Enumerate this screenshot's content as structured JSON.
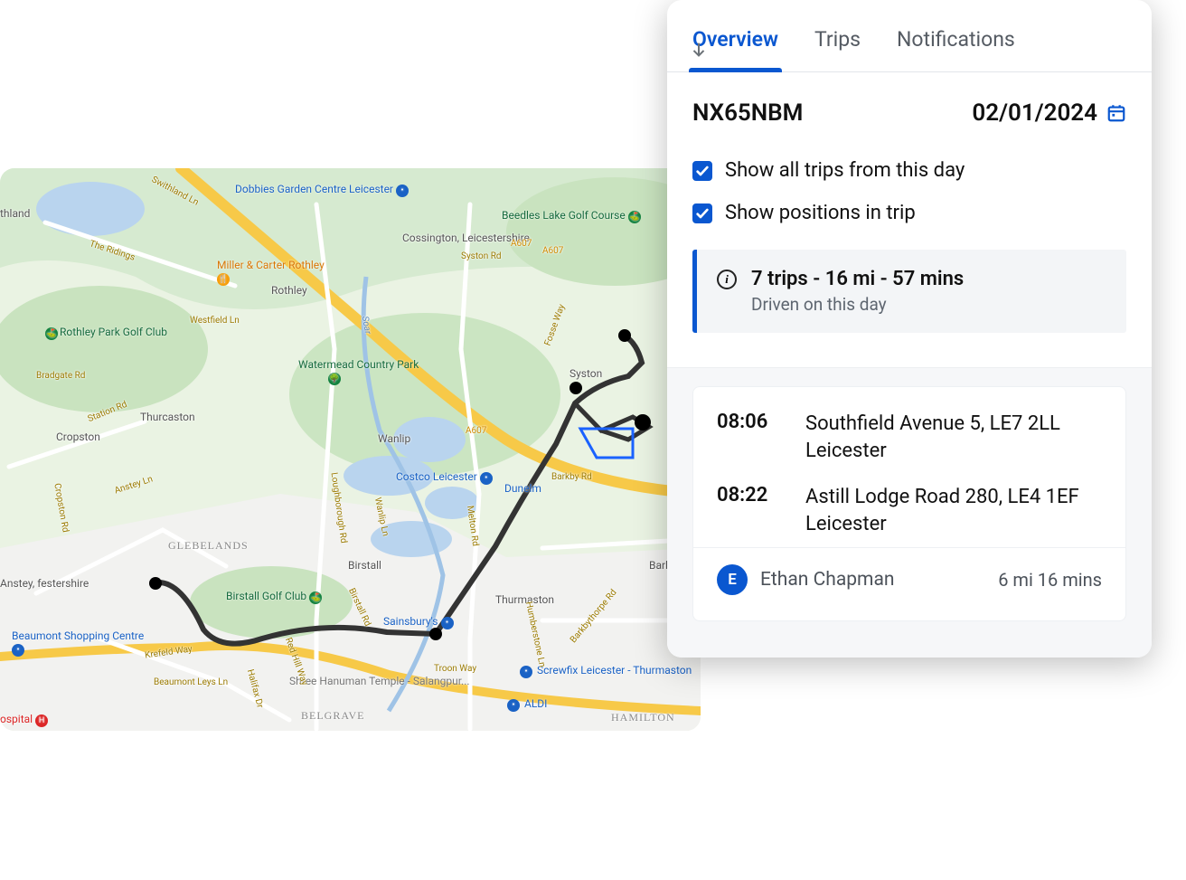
{
  "tabs": {
    "overview": "Overview",
    "trips": "Trips",
    "notifications": "Notifications"
  },
  "header": {
    "vehicle": "NX65NBM",
    "date": "02/01/2024"
  },
  "options": {
    "show_all_trips": "Show all trips from this day",
    "show_positions": "Show positions in trip"
  },
  "summary": {
    "title": "7 trips - 16 mi - 57 mins",
    "subtitle": "Driven on this day"
  },
  "trip": {
    "start_time": "08:06",
    "start_addr_line1": "Southfield Avenue 5, LE7 2LL",
    "start_addr_line2": "Leicester",
    "end_time": "08:22",
    "end_addr_line1": "Astill Lodge Road 280, LE4 1EF",
    "end_addr_line2": "Leicester",
    "driver_initial": "E",
    "driver_name": "Ethan Chapman",
    "meta": "6 mi 16 mins"
  },
  "map": {
    "places": {
      "rothley_golf": "Rothley Park Golf Club",
      "dobbies": "Dobbies Garden Centre Leicester",
      "miller": "Miller & Carter Rothley",
      "watermead": "Watermead Country Park",
      "beedles": "Beedles Lake Golf Course",
      "costco": "Costco Leicester",
      "dunelm": "Dunelm",
      "birstall_golf": "Birstall Golf Club",
      "sainsburys": "Sainsbury's",
      "beaumont": "Beaumont Shopping Centre",
      "shree": "Shree Hanuman Temple - Salangpur...",
      "screwfix": "Screwfix Leicester - Thurmaston",
      "aldi": "ALDI",
      "hospital": "ospital"
    },
    "towns": {
      "swithland": "thland",
      "rothley": "Rothley",
      "thurcaston": "Thurcaston",
      "cropston": "Cropston",
      "anstey": "Anstey, festershire",
      "wanlip": "Wanlip",
      "birstall": "Birstall",
      "syston": "Syston",
      "cossington": "Cossington, Leicestershire",
      "thurmaston": "Thurmaston",
      "barkby": "Barkt",
      "barkby_thorpe": "Barkby Thorpe"
    },
    "neigh": {
      "glebelands": "GLEBELANDS",
      "belgrave": "BELGRAVE",
      "hamilton": "HAMILTON"
    },
    "roads": {
      "ridings": "The Ridings",
      "swithland_ln": "Swithland Ln",
      "westfield": "Westfield Ln",
      "bradgate": "Bradgate Rd",
      "station": "Station Rd",
      "anstey_ln": "Anstey Ln",
      "cropston_rd": "Cropston Rd",
      "krefeld": "Krefeld Way",
      "halifax": "Halifax Dr",
      "redhill": "Red Hill Way",
      "beaumont_leys": "Beaumont Leys Ln",
      "loughborough": "Loughborough Rd",
      "wanlip_ln": "Wanlip Ln",
      "birstall_rd": "Birstall Rd",
      "melton": "Melton Rd",
      "humberstone": "Humberstone Ln",
      "troon": "Troon Way",
      "fosse": "Fosse Way",
      "syston_rd": "Syston Rd",
      "barkby_rd": "Barkby Rd",
      "barkbythorpe_rd": "Barkbythorpe Rd",
      "soar": "Soar",
      "a607_1": "A607",
      "a607_2": "A607",
      "a607_3": "A607"
    }
  }
}
